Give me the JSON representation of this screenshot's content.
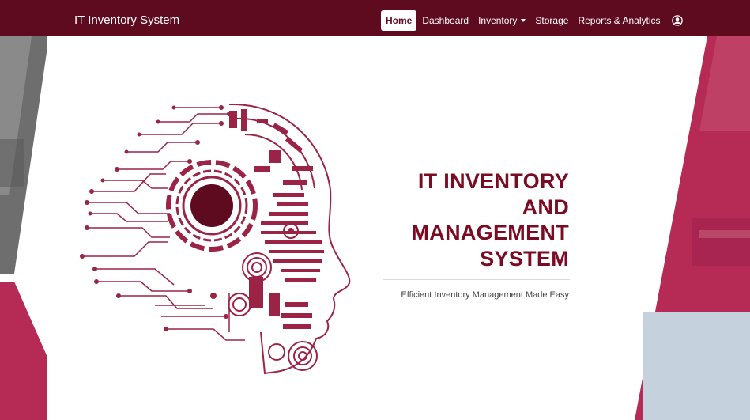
{
  "navbar": {
    "brand": "IT Inventory System",
    "items": [
      {
        "label": "Home",
        "active": true
      },
      {
        "label": "Dashboard"
      },
      {
        "label": "Inventory",
        "dropdown": true
      },
      {
        "label": "Storage"
      },
      {
        "label": "Reports & Analytics"
      }
    ],
    "user_icon": "user-circle-icon"
  },
  "hero": {
    "title_lines": [
      "IT INVENTORY",
      "AND",
      "MANAGEMENT",
      "SYSTEM"
    ],
    "subtitle": "Efficient Inventory Management Made Easy"
  },
  "colors": {
    "navbar_bg": "#5e0a1f",
    "accent": "#b52b56",
    "title": "#7b0b22",
    "art": "#9b2346",
    "gray_panel": "#c5d1dd"
  }
}
